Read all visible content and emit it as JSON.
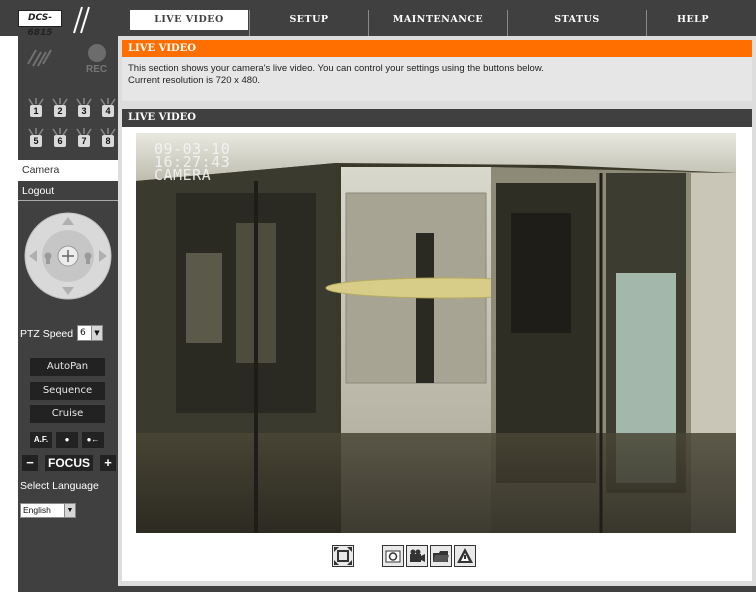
{
  "header": {
    "logo": "DCS-6815",
    "tabs": [
      {
        "label": "LIVE VIDEO",
        "active": true
      },
      {
        "label": "SETUP",
        "active": false
      },
      {
        "label": "MAINTENANCE",
        "active": false
      },
      {
        "label": "STATUS",
        "active": false
      },
      {
        "label": "HELP",
        "active": false
      }
    ]
  },
  "sidebar": {
    "rec_label": "REC",
    "io_inputs": [
      "1",
      "2",
      "3",
      "4",
      "5",
      "6",
      "7",
      "8"
    ],
    "nav": {
      "camera": "Camera",
      "logout": "Logout"
    },
    "ptz_speed_label": "PTZ Speed",
    "ptz_speed_value": "6",
    "buttons": {
      "autopan": "AutoPan",
      "sequence": "Sequence",
      "cruise": "Cruise"
    },
    "focus": {
      "af": "A.F.",
      "focus_label": "FOCUS",
      "minus": "−",
      "plus": "+"
    },
    "language_label": "Select Language",
    "language_value": "English"
  },
  "main": {
    "info_title": "LIVE VIDEO",
    "info_line1": "This section shows your camera's live video. You can control your settings using the buttons below.",
    "info_line2": "Current resolution is 720 x 480.",
    "live_title": "LIVE VIDEO",
    "osd": {
      "date": "09-03-10",
      "time": "16:27:43",
      "name": "CAMERA"
    },
    "controls": [
      "fullscreen-icon",
      "snapshot-icon",
      "record-icon",
      "storage-folder-icon",
      "audio-icon"
    ]
  },
  "colors": {
    "bar": "#404040",
    "accent": "#ff6f00",
    "panel": "#dddddd",
    "info_bg": "#e6e6e6"
  }
}
